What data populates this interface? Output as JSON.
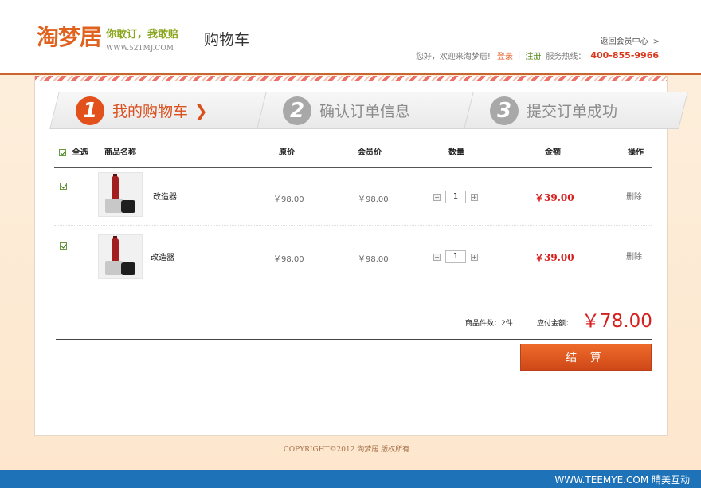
{
  "header": {
    "logo": "淘梦居",
    "slogan": "你敢订，我敢赔",
    "url": "WWW.52TMJ.COM",
    "page_title": "购物车",
    "member_center": "返回会员中心",
    "greeting": "您好，欢迎来淘梦居!",
    "login": "登录",
    "register": "注册",
    "hotline_label": "服务热线：",
    "hotline": "400-855-9966"
  },
  "steps": [
    {
      "num": "1",
      "label": "我的购物车",
      "active": true
    },
    {
      "num": "2",
      "label": "确认订单信息",
      "active": false
    },
    {
      "num": "3",
      "label": "提交订单成功",
      "active": false
    }
  ],
  "table": {
    "headers": {
      "select_all": "全选",
      "name": "商品名称",
      "original_price": "原价",
      "member_price": "会员价",
      "quantity": "数量",
      "amount": "金额",
      "action": "操作"
    },
    "rows": [
      {
        "name": "改造器",
        "original_price": "￥98.00",
        "member_price": "￥98.00",
        "quantity": "1",
        "amount": "￥39.00",
        "action": "删除"
      },
      {
        "name": "改造器",
        "original_price": "￥98.00",
        "member_price": "￥98.00",
        "quantity": "1",
        "amount": "￥39.00",
        "action": "删除"
      }
    ]
  },
  "summary": {
    "count": "商品件数：2件",
    "payable_label": "应付金额：",
    "total": "￥78.00"
  },
  "checkout_label": "结 算",
  "copyright": "COPYRIGHT©2012 淘梦居 版权所有",
  "footer_brand": "WWW.TEEMYE.COM 晴美互动",
  "colors": {
    "brand_orange": "#e0621f",
    "price_red": "#d62020",
    "footer_blue": "#1d72b8"
  }
}
